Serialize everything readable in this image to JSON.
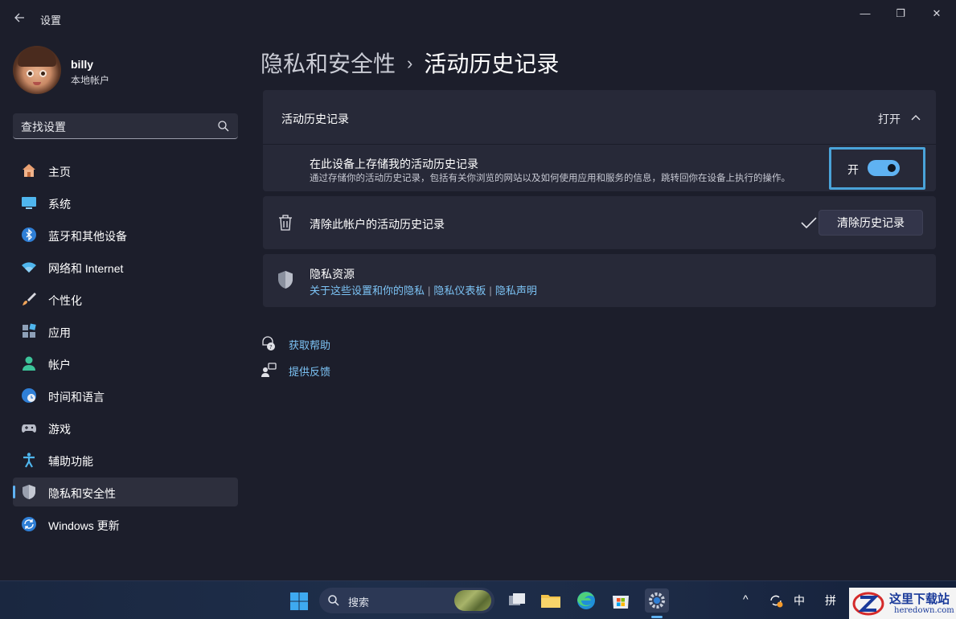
{
  "window": {
    "title": "设置",
    "controls": {
      "minimize": "—",
      "maximize": "❐",
      "close": "✕"
    }
  },
  "profile": {
    "name": "billy",
    "account_type": "本地帐户"
  },
  "search": {
    "placeholder": "查找设置"
  },
  "nav": {
    "items": [
      {
        "label": "主页",
        "icon": "home-icon"
      },
      {
        "label": "系统",
        "icon": "system-icon"
      },
      {
        "label": "蓝牙和其他设备",
        "icon": "bluetooth-icon"
      },
      {
        "label": "网络和 Internet",
        "icon": "wifi-icon"
      },
      {
        "label": "个性化",
        "icon": "brush-icon"
      },
      {
        "label": "应用",
        "icon": "apps-icon"
      },
      {
        "label": "帐户",
        "icon": "account-icon"
      },
      {
        "label": "时间和语言",
        "icon": "globe-clock-icon"
      },
      {
        "label": "游戏",
        "icon": "gamepad-icon"
      },
      {
        "label": "辅助功能",
        "icon": "accessibility-icon"
      },
      {
        "label": "隐私和安全性",
        "icon": "shield-icon",
        "active": true
      },
      {
        "label": "Windows 更新",
        "icon": "update-icon"
      }
    ]
  },
  "breadcrumb": {
    "parent": "隐私和安全性",
    "separator": "›",
    "current": "活动历史记录"
  },
  "activity": {
    "section_title": "活动历史记录",
    "section_state": "打开",
    "store_title": "在此设备上存储我的活动历史记录",
    "store_desc": "通过存储你的活动历史记录，包括有关你浏览的网站以及如何使用应用和服务的信息，跳转回你在设备上执行的操作。",
    "toggle_label": "开",
    "toggle_on": true
  },
  "clear": {
    "label": "清除此帐户的活动历史记录",
    "button": "清除历史记录"
  },
  "privacy": {
    "title": "隐私资源",
    "links": [
      "关于这些设置和你的隐私",
      "隐私仪表板",
      "隐私声明"
    ],
    "separator": "|"
  },
  "help": {
    "get_help": "获取帮助",
    "feedback": "提供反馈"
  },
  "taskbar": {
    "search_text": "搜索",
    "tray": {
      "ime_lang": "中",
      "ime_mode": "拼",
      "overflow": "^"
    }
  },
  "watermark": {
    "title": "这里下载站",
    "url": "heredown.com"
  },
  "colors": {
    "accent": "#5fb2f2",
    "link": "#7cc3f5",
    "background": "#1c1e2b",
    "card": "#272938"
  }
}
